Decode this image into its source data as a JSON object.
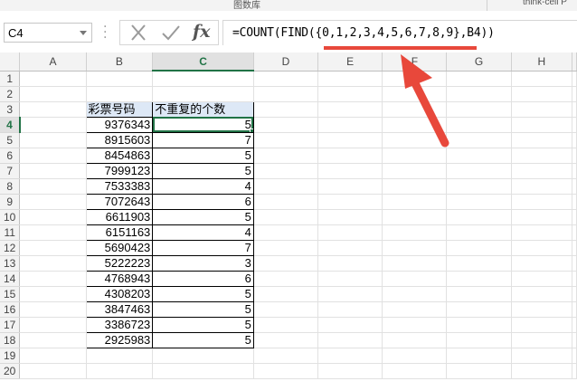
{
  "ribbon": {
    "group_left": "图数库",
    "group_right": "think-cell P"
  },
  "formula_bar": {
    "name_box": "C4",
    "cancel_icon": "close-icon",
    "enter_icon": "check-icon",
    "fx_label": "fx",
    "formula": "=COUNT(FIND({0,1,2,3,4,5,6,7,8,9},B4))"
  },
  "sheet": {
    "columns": [
      "A",
      "B",
      "C",
      "D",
      "E",
      "F",
      "G",
      "H"
    ],
    "selected_column": "C",
    "selected_row": 4,
    "rows": [
      {
        "n": "1",
        "b": "",
        "c": ""
      },
      {
        "n": "2",
        "b": "",
        "c": ""
      },
      {
        "n": "3",
        "b": "彩票号码",
        "c": "不重复的个数"
      },
      {
        "n": "4",
        "b": "9376343",
        "c": "5"
      },
      {
        "n": "5",
        "b": "8915603",
        "c": "7"
      },
      {
        "n": "6",
        "b": "8454863",
        "c": "5"
      },
      {
        "n": "7",
        "b": "7999123",
        "c": "5"
      },
      {
        "n": "8",
        "b": "7533383",
        "c": "4"
      },
      {
        "n": "9",
        "b": "7072643",
        "c": "6"
      },
      {
        "n": "10",
        "b": "6611903",
        "c": "5"
      },
      {
        "n": "11",
        "b": "6151163",
        "c": "4"
      },
      {
        "n": "12",
        "b": "5690423",
        "c": "7"
      },
      {
        "n": "13",
        "b": "5222223",
        "c": "3"
      },
      {
        "n": "14",
        "b": "4768943",
        "c": "6"
      },
      {
        "n": "15",
        "b": "4308203",
        "c": "5"
      },
      {
        "n": "16",
        "b": "3847463",
        "c": "5"
      },
      {
        "n": "17",
        "b": "3386723",
        "c": "5"
      },
      {
        "n": "18",
        "b": "2925983",
        "c": "5"
      },
      {
        "n": "19",
        "b": "",
        "c": ""
      },
      {
        "n": "20",
        "b": "",
        "c": ""
      }
    ]
  },
  "annotation": {
    "color": "#e8483b"
  },
  "colors": {
    "accent": "#217346",
    "header_bg": "#dde8f6"
  }
}
